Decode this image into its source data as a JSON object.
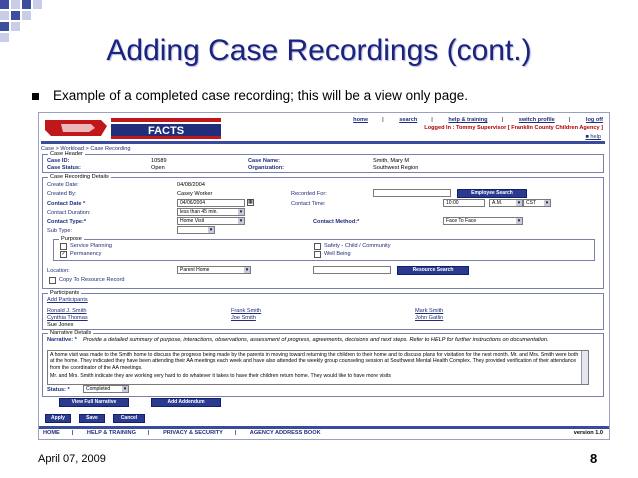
{
  "slide": {
    "title": "Adding Case Recordings (cont.)",
    "bullet": "Example of a completed case recording; this will be a view only page.",
    "date": "April 07, 2009",
    "page": "8"
  },
  "colors": {
    "title": "#1a237e",
    "nav": "#1f2d7a",
    "bar": "#3a4a9c",
    "button": "#2a3b8f",
    "logged": "#b00000"
  },
  "app": {
    "logo_text": "FACTS",
    "nav": [
      "home",
      "search",
      "help & training",
      "switch profile",
      "log off"
    ],
    "logged_in": "Logged In : Tommy Supervisor [ Franklin County Children Agency ]",
    "help_link": "help",
    "breadcrumb": "Case > Workload > Case Recording"
  },
  "case_header": {
    "legend": "Case Header",
    "case_id_label": "Case ID:",
    "case_id": "10589",
    "case_status_label": "Case Status:",
    "case_status": "Open",
    "case_name_label": "Case Name:",
    "case_name": "Smith, Mary M",
    "org_label": "Organization:",
    "org": "Southwest Region"
  },
  "details": {
    "legend": "Case Recording Details",
    "create_date_label": "Create Date:",
    "create_date": "04/08/2004",
    "created_by_label": "Created By:",
    "created_by": "Casey Worker",
    "recorded_for_label": "Recorded For:",
    "employee_search": "Employee Search",
    "contact_date_label": "Contact Date *",
    "contact_date": "04/06/2004",
    "contact_time_label": "Contact Time:",
    "contact_time": "10:00",
    "ampm": "A.M.",
    "tz": "CST",
    "contact_duration_label": "Contact Duration:",
    "contact_duration": "less than 45 min.",
    "contact_type_label": "Contact Type:*",
    "contact_type": "Home Visit",
    "contact_method_label": "Contact Method:*",
    "contact_method": "Face To Face",
    "sub_type_label": "Sub Type:",
    "purpose_legend": "Purpose",
    "purpose": [
      {
        "label": "Service Planning",
        "checked": ""
      },
      {
        "label": "Safety - Child / Community",
        "checked": ""
      },
      {
        "label": "Permanency",
        "checked": "✓"
      },
      {
        "label": "Well Being",
        "checked": ""
      }
    ],
    "location_label": "Location:",
    "location": "Parent Home",
    "resource_search": "Resource Search",
    "copy_resource": "Copy To Resource Record"
  },
  "participants": {
    "legend": "Participants",
    "add": "Add Participants",
    "names": [
      "Ronald J. Smith",
      "Frank Smith",
      "Mark Smith",
      "Cynthia Thomas",
      "Joe Smith",
      "John Gatlin",
      "Sue Jones"
    ]
  },
  "narrative": {
    "legend": "Narrative Details",
    "label": "Narrative: *",
    "instructions": "Provide a detailed summary of purpose, interactions, observations, assessment of progress, agreements, decisions and next steps. Refer to HELP for further instructions on documentation.",
    "text1": "A home visit was made to the Smith home to discuss the progress being made by the parents in moving toward returning the children to their home and to discuss plans for visitation for the next month. Mr. and Mrs. Smith were both at the home. They indicated they have been attending their AA meetings each week and have also attended the weekly group counseling session at Southwest Mental Health Complex. They provided verification of their attendance from the coordinator of the AA meetings.",
    "text2": "Mr. and Mrs. Smith indicate they are working very hard to do whatever it takes to have their children return home. They would like to have more visits",
    "status_label": "Status: *",
    "status": "Completed",
    "view_full": "View Full Narrative",
    "add_addendum": "Add Addendum"
  },
  "actions": [
    "Apply",
    "Save",
    "Cancel"
  ],
  "footer": {
    "links": [
      "HOME",
      "HELP & TRAINING",
      "PRIVACY & SECURITY",
      "AGENCY ADDRESS BOOK"
    ],
    "version": "version 1.0"
  }
}
